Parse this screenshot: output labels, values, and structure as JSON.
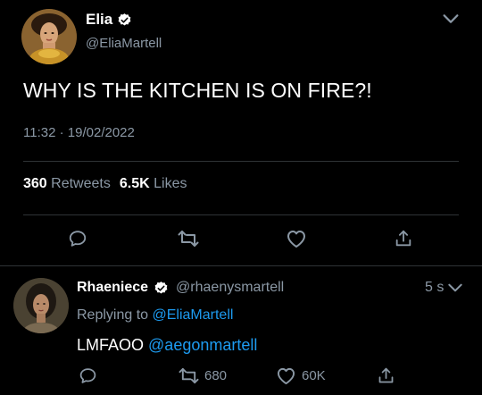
{
  "colors": {
    "background": "#000000",
    "text": "#e7e9ea",
    "secondary_text": "#8b98a5",
    "accent": "#1d9bf0",
    "divider": "#2f3336",
    "verified_badge": "#ffffff"
  },
  "tweet": {
    "display_name": "Elia",
    "handle": "@EliaMartell",
    "text": "WHY IS THE KITCHEN IS ON FIRE?!",
    "time": "11:32",
    "separator": "·",
    "date": "19/02/2022",
    "retweets_count": "360",
    "retweets_label": "Retweets",
    "likes_count": "6.5K",
    "likes_label": "Likes",
    "icons": {
      "verified": "verified-badge-icon",
      "menu": "chevron-down-icon",
      "reply": "reply-icon",
      "retweet": "retweet-icon",
      "like": "heart-icon",
      "share": "share-icon"
    }
  },
  "reply": {
    "display_name": "Rhaeniece",
    "handle": "@rhaenysmartell",
    "time": "5 s",
    "replying_prefix": "Replying to",
    "replying_to": "@EliaMartell",
    "text": "LMFAOO",
    "mention": "@aegonmartell",
    "retweet_count": "680",
    "like_count": "60K"
  }
}
